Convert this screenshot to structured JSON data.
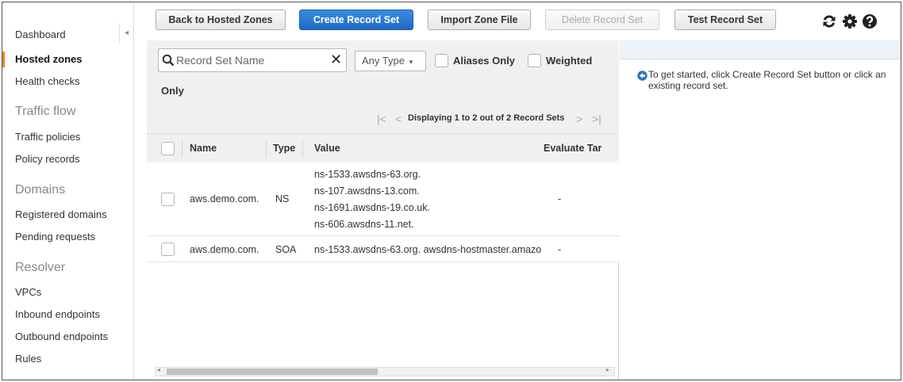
{
  "sidebar": {
    "items": [
      {
        "label": "Dashboard"
      },
      {
        "label": "Hosted zones"
      },
      {
        "label": "Health checks"
      },
      {
        "label": "Traffic policies"
      },
      {
        "label": "Policy records"
      },
      {
        "label": "Registered domains"
      },
      {
        "label": "Pending requests"
      },
      {
        "label": "VPCs"
      },
      {
        "label": "Inbound endpoints"
      },
      {
        "label": "Outbound endpoints"
      },
      {
        "label": "Rules"
      }
    ],
    "sections": {
      "traffic_flow": "Traffic flow",
      "domains": "Domains",
      "resolver": "Resolver"
    },
    "collapse_glyph": "◂"
  },
  "toolbar": {
    "back_label": "Back to Hosted Zones",
    "create_label": "Create Record Set",
    "import_label": "Import Zone File",
    "delete_label": "Delete Record Set",
    "test_label": "Test Record Set",
    "icons": [
      "refresh-icon",
      "gear-icon",
      "help-icon"
    ]
  },
  "filter": {
    "search_placeholder": "Record Set Name",
    "clear_glyph": "✕",
    "type_label": "Any Type",
    "type_caret": "▾",
    "aliases_label": "Aliases Only",
    "weighted_label": "Weighted",
    "only_label": "Only"
  },
  "pagination": {
    "text": "Displaying 1 to 2 out of 2 Record Sets",
    "first": "|<",
    "prev": "<",
    "next": ">",
    "last": ">|"
  },
  "table": {
    "columns": [
      "Name",
      "Type",
      "Value",
      "Evaluate Tar"
    ],
    "rows": [
      {
        "name": "aws.demo.com.",
        "type": "NS",
        "values": [
          "ns-1533.awsdns-63.org.",
          "ns-107.awsdns-13.com.",
          "ns-1691.awsdns-19.co.uk.",
          "ns-606.awsdns-11.net."
        ],
        "evaluate": "-"
      },
      {
        "name": "aws.demo.com.",
        "type": "SOA",
        "values": [
          "ns-1533.awsdns-63.org. awsdns-hostmaster.amazo"
        ],
        "evaluate": "-"
      }
    ]
  },
  "scroll": {
    "left_arrow": "◂",
    "right_arrow": "▸"
  },
  "info": {
    "text": "To get started, click Create Record Set button or click an existing record set."
  },
  "colors": {
    "primary_button": "#1e6ac4",
    "active_marker": "#e7861e",
    "info_icon": "#2a74c9"
  }
}
